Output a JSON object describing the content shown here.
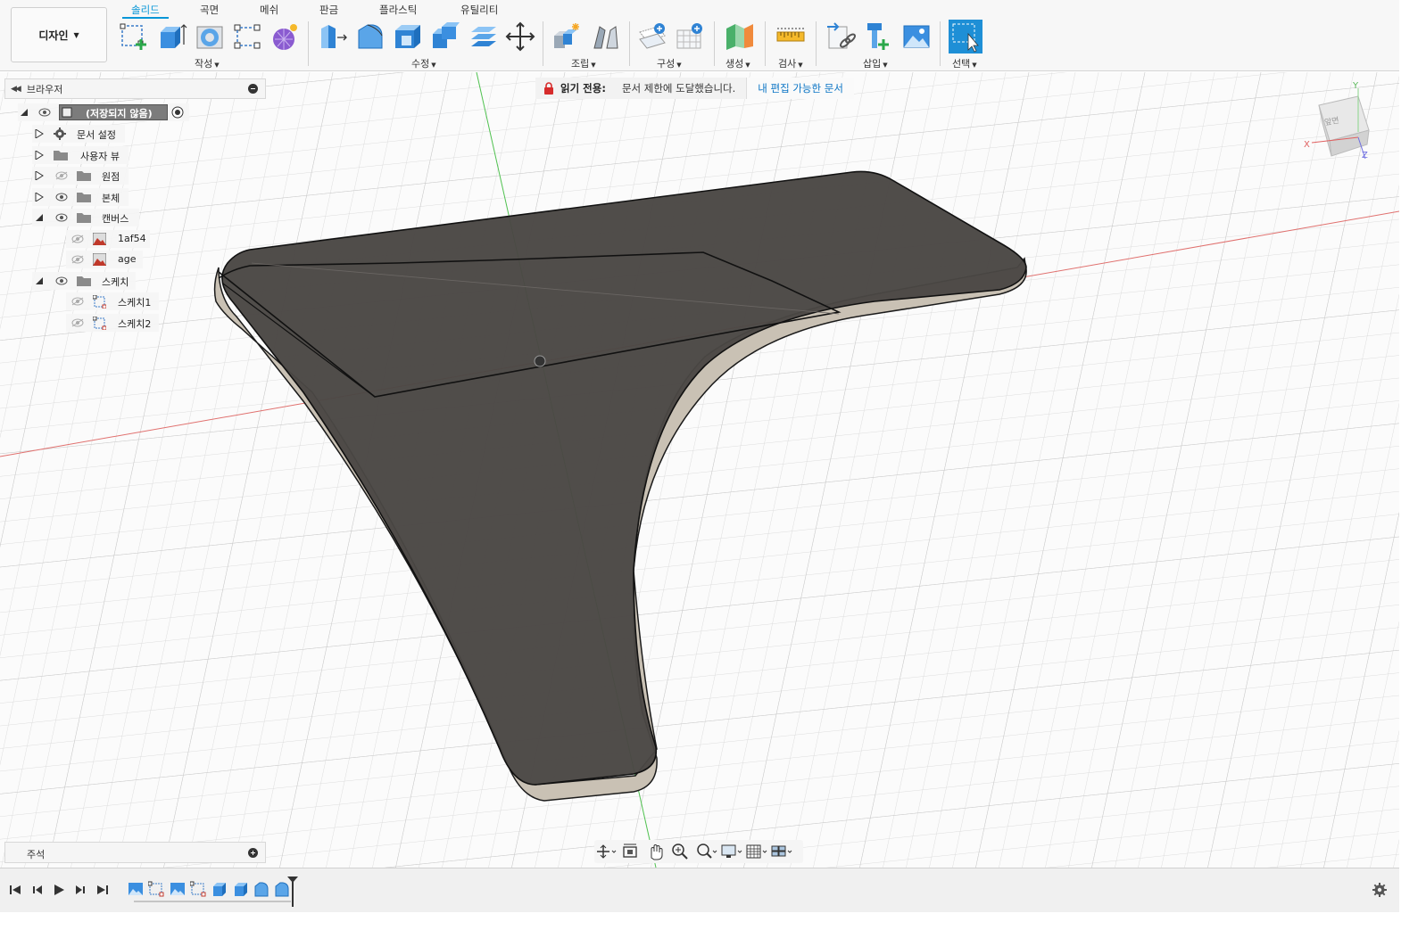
{
  "workspace": {
    "label": "디자인"
  },
  "tabs": [
    {
      "label": "솔리드",
      "active": true
    },
    {
      "label": "곡면",
      "active": false
    },
    {
      "label": "메쉬",
      "active": false
    },
    {
      "label": "판금",
      "active": false
    },
    {
      "label": "플라스틱",
      "active": false
    },
    {
      "label": "유틸리티",
      "active": false
    }
  ],
  "tool_groups": [
    {
      "label": "작성",
      "icons": [
        "create-sketch-icon",
        "extrude-icon",
        "revolve-icon",
        "sketch-constraint-icon",
        "form-icon"
      ]
    },
    {
      "label": "수정",
      "icons": [
        "press-pull-icon",
        "fillet-icon",
        "shell-icon",
        "combine-icon",
        "offset-face-icon",
        "move-icon"
      ]
    },
    {
      "label": "조립",
      "icons": [
        "new-component-icon",
        "joint-icon"
      ]
    },
    {
      "label": "구성",
      "icons": [
        "offset-plane-icon",
        "construction-grid-icon"
      ]
    },
    {
      "label": "생성",
      "icons": [
        "generate-icon"
      ]
    },
    {
      "label": "검사",
      "icons": [
        "measure-icon"
      ]
    },
    {
      "label": "삽입",
      "icons": [
        "insert-link-icon",
        "insert-mcmaster-icon",
        "canvas-image-icon"
      ]
    },
    {
      "label": "선택",
      "icons": [
        "select-icon"
      ]
    }
  ],
  "banner": {
    "label": "읽기 전용:",
    "message": "문서 제한에 도달했습니다.",
    "link": "내 편집 가능한 문서"
  },
  "browser": {
    "title": "브라우저",
    "root": "(저장되지 않음)",
    "items": [
      {
        "label": "문서 설정",
        "icon": "gear-icon"
      },
      {
        "label": "사용자 뷰",
        "icon": "folder-icon"
      },
      {
        "label": "원점",
        "icon": "folder-icon"
      },
      {
        "label": "본체",
        "icon": "folder-icon"
      },
      {
        "label": "캔버스",
        "icon": "folder-icon"
      },
      {
        "label": "1af54",
        "icon": "canvas-image-icon"
      },
      {
        "label": "age",
        "icon": "canvas-image-icon"
      },
      {
        "label": "스케치",
        "icon": "folder-icon"
      },
      {
        "label": "스케치1",
        "icon": "sketch-icon"
      },
      {
        "label": "스케치2",
        "icon": "sketch-icon"
      }
    ]
  },
  "comments": {
    "title": "주석"
  },
  "viewcube": {
    "face": "앞면",
    "axis_x": "X",
    "axis_y": "Y",
    "axis_z": "Z"
  },
  "navbar": {
    "icons": [
      "orbit-icon",
      "look-at-icon",
      "pan-icon",
      "zoom-icon",
      "fit-icon",
      "display-settings-icon",
      "grid-icon",
      "viewports-icon"
    ]
  },
  "timeline": {
    "controls": [
      "go-to-start-icon",
      "step-back-icon",
      "play-icon",
      "step-forward-icon",
      "go-to-end-icon"
    ],
    "features": [
      "canvas-feature-icon",
      "sketch-feature-icon",
      "canvas-feature-icon",
      "sketch-feature-icon",
      "extrude-feature-icon",
      "extrude-feature-icon",
      "fillet-feature-icon",
      "fillet-feature-icon"
    ]
  },
  "colors": {
    "accent": "#0696d7",
    "body_face": "#4a4744",
    "body_side": "#c9c1b4",
    "grid": "#dcdcdc",
    "x_axis": "#e0706e",
    "y_axis": "#4fc14f"
  }
}
